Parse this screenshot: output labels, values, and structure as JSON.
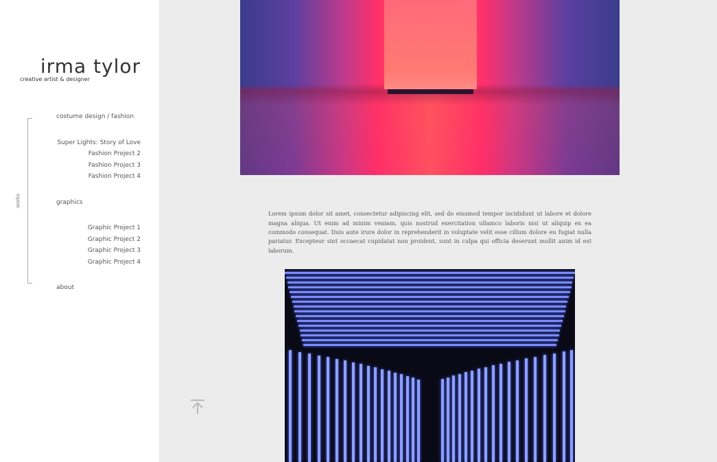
{
  "brand": {
    "name": "irma tylor",
    "tagline": "creative artist & designer"
  },
  "sidebar": {
    "works_label": "works",
    "sections": [
      {
        "title": "costume design / fashion",
        "items": [
          "Super Lights: Story of Love",
          "Fashion Project 2",
          "Fashion Project 3",
          "Fashion Project 4"
        ]
      },
      {
        "title": "graphics",
        "items": [
          "Graphic Project 1",
          "Graphic Project 2",
          "Graphic Project 3",
          "Graphic Project 4"
        ]
      },
      {
        "title": "about",
        "items": []
      }
    ]
  },
  "content": {
    "paragraph": "Lorem ipsum dolor sit amet, consectetur adipiscing elit, sed do eiusmod tempor incididunt ut labore et dolore magna aliqua. Ut enim ad minim veniam, quis nostrud exercitation ullamco laboris nisi ut aliquip ex ea commodo consequat. Duis aute irure dolor in reprehenderit in voluptate velit esse cillum dolore eu fugiat nulla pariatur. Excepteur sint occaecat cupidatat non proident, sunt in culpa qui officia deserunt mollit anim id est laborum."
  },
  "icons": {
    "scroll_top": "arrow-up-to-line-icon"
  },
  "colors": {
    "sidebar_bg": "#ffffff",
    "content_bg": "#ececec",
    "text": "#555555",
    "brand_text": "#333333"
  }
}
